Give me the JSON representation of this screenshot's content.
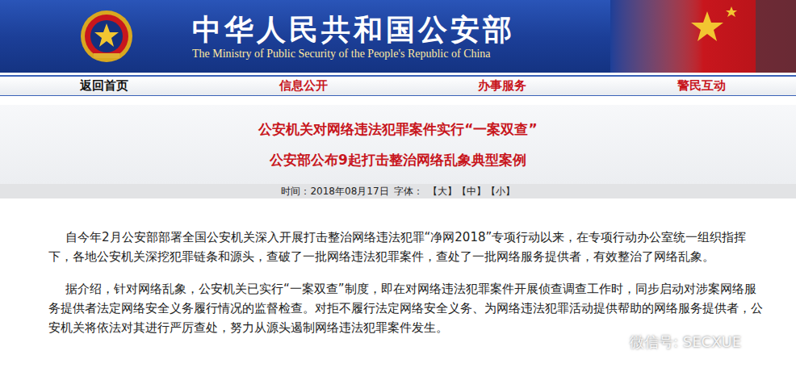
{
  "header": {
    "title": "中华人民共和国公安部",
    "subtitle": "The Ministry of Public Security of the People's Republic of China"
  },
  "nav": [
    {
      "label": "返回首页",
      "selected": true
    },
    {
      "label": "信息公开",
      "selected": false
    },
    {
      "label": "办事服务",
      "selected": false
    },
    {
      "label": "警民互动",
      "selected": false
    }
  ],
  "article": {
    "title": "公安机关对网络违法犯罪案件实行“一案双查”",
    "subtitle": "公安部公布9起打击整治网络乱象典型案例",
    "meta": {
      "time": "时间：2018年08月17日",
      "font_label": "字体：",
      "sizes": [
        "【大】",
        "【中】",
        "【小】"
      ]
    },
    "paragraphs": [
      "自今年2月公安部部署全国公安机关深入开展打击整治网络违法犯罪“净网2018”专项行动以来，在专项行动办公室统一组织指挥下，各地公安机关深挖犯罪链条和源头，查破了一批网络违法犯罪案件，查处了一批网络服务提供者，有效整治了网络乱象。",
      "据介绍，针对网络乱象，公安机关已实行“一案双查”制度，即在对网络违法犯罪案件开展侦查调查工作时，同步启动对涉案网络服务提供者法定网络安全义务履行情况的监督检查。对拒不履行法定网络安全义务、为网络违法犯罪活动提供帮助的网络服务提供者，公安机关将依法对其进行严厉查处，努力从源头遏制网络违法犯罪案件发生。"
    ]
  },
  "watermark": "微信号: SECXUE"
}
